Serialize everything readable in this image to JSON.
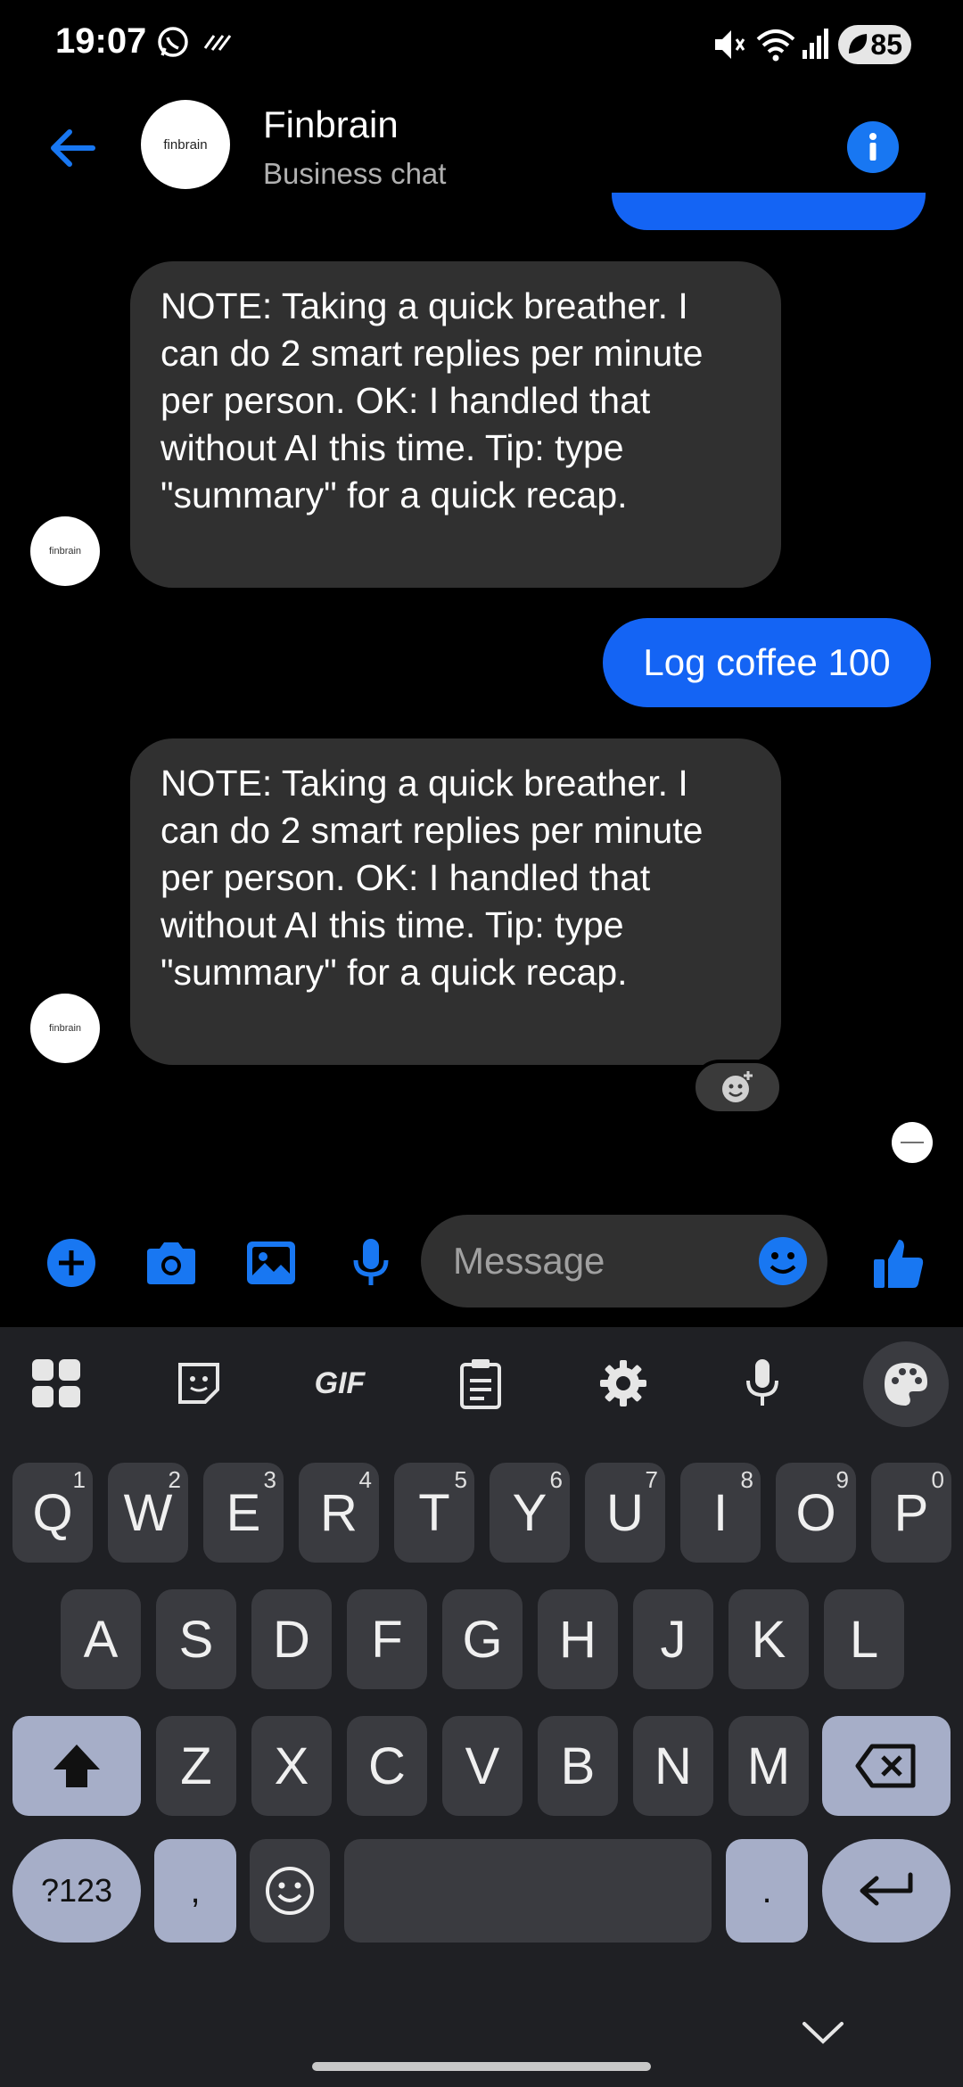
{
  "status_bar": {
    "time": "19:07",
    "battery": "85"
  },
  "header": {
    "title": "Finbrain",
    "subtitle": "Business chat",
    "avatar_text": "finbrain"
  },
  "messages": [
    {
      "from": "bot",
      "text": "NOTE: Taking a quick breather. I can do 2 smart replies per minute per person. OK: I handled that without AI this time. Tip: type \"summary\" for a quick recap.",
      "avatar_text": "finbrain"
    },
    {
      "from": "user",
      "text": "Log coffee 100"
    },
    {
      "from": "bot",
      "text": "NOTE: Taking a quick breather. I can do 2 smart replies per minute per person. OK: I handled that without AI this time. Tip: type \"summary\" for a quick recap.",
      "avatar_text": "finbrain"
    }
  ],
  "composer": {
    "placeholder": "Message"
  },
  "keyboard": {
    "toolbar": {
      "gif_label": "GIF"
    },
    "row1": [
      {
        "k": "Q",
        "h": "1"
      },
      {
        "k": "W",
        "h": "2"
      },
      {
        "k": "E",
        "h": "3"
      },
      {
        "k": "R",
        "h": "4"
      },
      {
        "k": "T",
        "h": "5"
      },
      {
        "k": "Y",
        "h": "6"
      },
      {
        "k": "U",
        "h": "7"
      },
      {
        "k": "I",
        "h": "8"
      },
      {
        "k": "O",
        "h": "9"
      },
      {
        "k": "P",
        "h": "0"
      }
    ],
    "row2": [
      "A",
      "S",
      "D",
      "F",
      "G",
      "H",
      "J",
      "K",
      "L"
    ],
    "row3": [
      "Z",
      "X",
      "C",
      "V",
      "B",
      "N",
      "M"
    ],
    "symbols_label": "?123",
    "comma_label": ",",
    "period_label": "."
  },
  "colors": {
    "accent": "#1877f2",
    "outgoing_bubble": "#1464f4",
    "incoming_bubble": "#303030",
    "keyboard_bg": "#1f2024"
  }
}
